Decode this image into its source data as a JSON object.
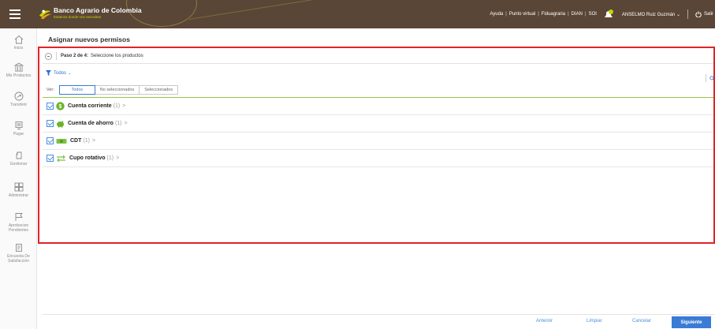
{
  "header": {
    "brand_name": "Banco Agrario de Colombia",
    "brand_slogan": "Estamos donde nos necesitan",
    "links": [
      "Ayuda",
      "Punto virtual",
      "Fiduagraria",
      "DIAN",
      "SOI"
    ],
    "user_name": "ANSELMO Ruiz Guzmán",
    "user_chevron": "⌄",
    "logout_label": "Salir"
  },
  "sidebar": {
    "items": [
      {
        "label": "Inicio",
        "icon": "home-icon"
      },
      {
        "label": "Mis Productos",
        "icon": "bank-icon"
      },
      {
        "label": "Transferir",
        "icon": "transfer-icon"
      },
      {
        "label": "Pagar",
        "icon": "pay-icon"
      },
      {
        "label": "Gestionar",
        "icon": "manage-icon"
      },
      {
        "label": "Administrar",
        "icon": "admin-icon"
      },
      {
        "label": "Aprobacion Pendientes",
        "icon": "flag-icon"
      },
      {
        "label": "Encuesta De Satisfacción",
        "icon": "survey-icon"
      }
    ]
  },
  "main": {
    "title": "Asignar nuevos permisos",
    "step_bold": "Paso 2 de 4:",
    "step_text": "Seleccione los productos",
    "filter_label": "Todos",
    "ver_label": "Ver:",
    "view_tabs": [
      "Todos",
      "No seleccionados",
      "Seleccionados"
    ],
    "active_view": "Todos",
    "products": [
      {
        "name": "Cuenta corriente",
        "count": "(1)",
        "icon": "dollar-circle-icon",
        "checked": true
      },
      {
        "name": "Cuenta de ahorro",
        "count": "(1)",
        "icon": "piggy-bank-icon",
        "checked": true
      },
      {
        "name": "CDT",
        "count": "(1)",
        "icon": "banknote-icon",
        "checked": true
      },
      {
        "name": "Cupo rotativo",
        "count": "(1)",
        "icon": "rotate-arrows-icon",
        "checked": true
      }
    ],
    "chevron": ">"
  },
  "footer": {
    "anterior": "Anterior",
    "limpiar": "Limpiar",
    "cancelar": "Cancelar",
    "siguiente": "Siguiente"
  },
  "colors": {
    "header_bg": "#5a4636",
    "accent_blue": "#3a7bd5",
    "accent_green": "#9cc44a",
    "highlight_red": "#e02424",
    "slogan_lime": "#c4d600"
  }
}
